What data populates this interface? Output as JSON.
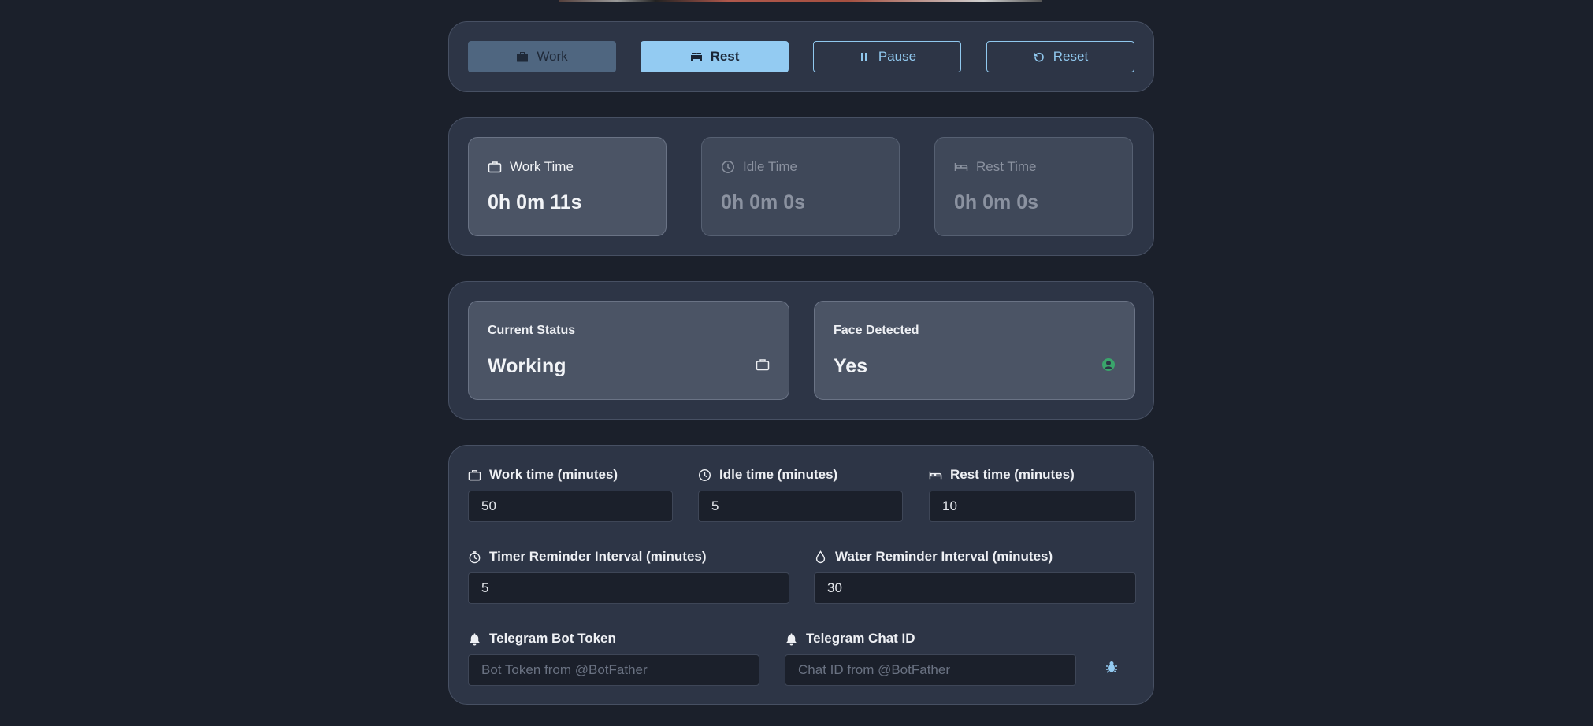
{
  "controls": {
    "work_label": "Work",
    "rest_label": "Rest",
    "pause_label": "Pause",
    "reset_label": "Reset"
  },
  "timers": {
    "work": {
      "label": "Work Time",
      "value": "0h 0m 11s"
    },
    "idle": {
      "label": "Idle Time",
      "value": "0h 0m 0s"
    },
    "rest": {
      "label": "Rest Time",
      "value": "0h 0m 0s"
    }
  },
  "status": {
    "current": {
      "label": "Current Status",
      "value": "Working",
      "icon": "briefcase-icon"
    },
    "face": {
      "label": "Face Detected",
      "value": "Yes",
      "icon": "user-circle-icon",
      "icon_color": "#3aa56b"
    }
  },
  "settings": {
    "work_time": {
      "label": "Work time (minutes)",
      "value": "50"
    },
    "idle_time": {
      "label": "Idle time (minutes)",
      "value": "5"
    },
    "rest_time": {
      "label": "Rest time (minutes)",
      "value": "10"
    },
    "timer_reminder": {
      "label": "Timer Reminder Interval (minutes)",
      "value": "5"
    },
    "water_reminder": {
      "label": "Water Reminder Interval (minutes)",
      "value": "30"
    },
    "bot_token": {
      "label": "Telegram Bot Token",
      "value": "",
      "placeholder": "Bot Token from @BotFather"
    },
    "chat_id": {
      "label": "Telegram Chat ID",
      "value": "",
      "placeholder": "Chat ID from @BotFather"
    }
  },
  "colors": {
    "accent": "#93cbf2",
    "background": "#1b202b",
    "card": "#2d3546"
  }
}
